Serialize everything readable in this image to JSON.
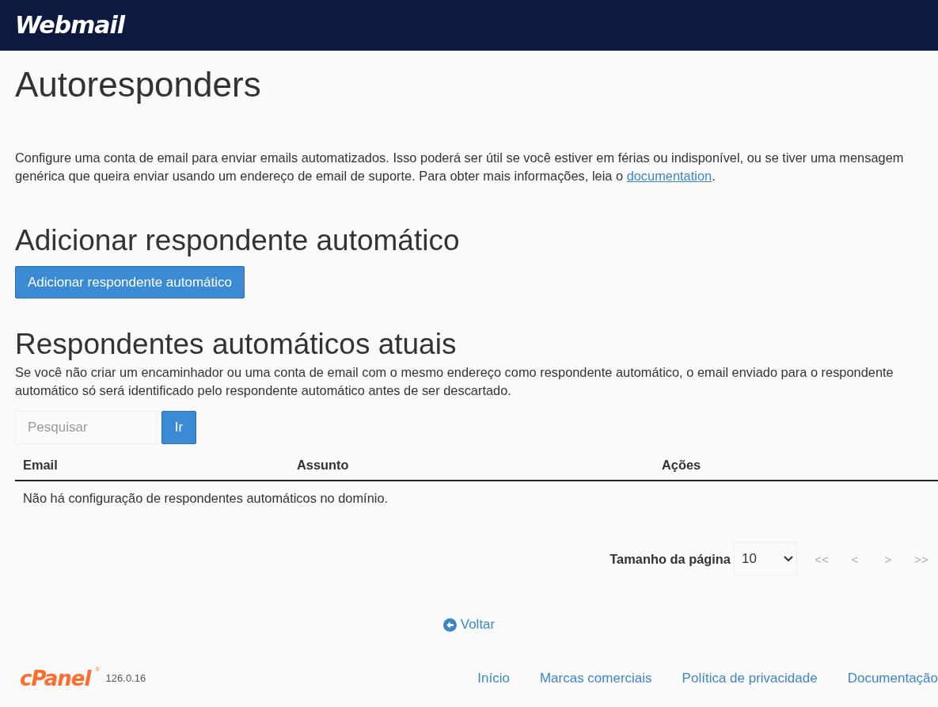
{
  "header": {
    "logo": "Webmail"
  },
  "page_title": "Autoresponders",
  "intro": {
    "text": "Configure uma conta de email para enviar emails automatizados. Isso poderá ser útil se você estiver em férias ou indisponível, ou se tiver uma mensagem genérica que queira enviar usando um endereço de email de suporte. Para obter mais informações, leia o ",
    "link": "documentation",
    "after": "."
  },
  "add_section": {
    "heading": "Adicionar respondente automático",
    "button": "Adicionar respondente automático"
  },
  "current_section": {
    "heading": "Respondentes automáticos atuais",
    "description": "Se você não criar um encaminhador ou uma conta de email com o mesmo endereço como respondente automático, o email enviado para o respondente automático só será identificado pelo respondente automático antes de ser descartado.",
    "search": {
      "placeholder": "Pesquisar",
      "button": "Ir"
    },
    "table": {
      "columns": [
        "Email",
        "Assunto",
        "Ações"
      ],
      "empty_message": "Não há configuração de respondentes automáticos no domínio."
    },
    "pagination": {
      "label": "Tamanho da página",
      "page_size": "10",
      "buttons": [
        {
          "label": "<<",
          "disabled": true
        },
        {
          "label": "<",
          "disabled": true
        },
        {
          "label": ">",
          "disabled": true
        },
        {
          "label": ">>",
          "disabled": true
        }
      ]
    }
  },
  "back_link": "Voltar",
  "footer": {
    "logo": "cPanel",
    "logo_mark": "®",
    "version": "126.0.16",
    "links": [
      "Início",
      "Marcas comerciais",
      "Política de privacidade",
      "Documentação"
    ]
  }
}
